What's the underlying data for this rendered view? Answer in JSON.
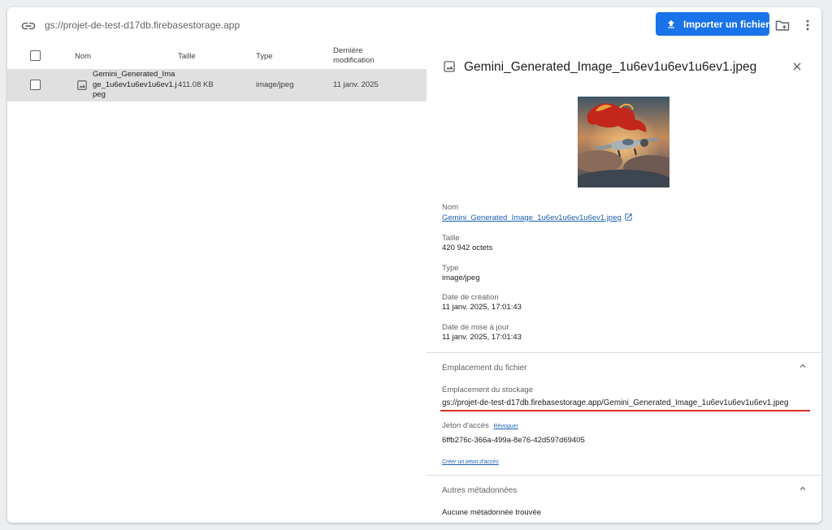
{
  "topbar": {
    "bucket_path": "gs://projet-de-test-d17db.firebasestorage.app",
    "upload_label": "Importer un fichier",
    "icons": [
      "link-icon",
      "upload-icon",
      "create-folder-icon",
      "more-vert-icon"
    ]
  },
  "table": {
    "columns": {
      "name": "Nom",
      "size": "Taille",
      "type": "Type",
      "modified": "Dernière modification"
    },
    "rows": [
      {
        "name": "Gemini_Generated_Image_1u6ev1u6ev1u6ev1.jpeg",
        "size": "411.08 KB",
        "type": "image/jpeg",
        "modified": "11 janv. 2025"
      }
    ]
  },
  "panel": {
    "title": "Gemini_Generated_Image_1u6ev1u6ev1u6ev1.jpeg",
    "fields": {
      "name_label": "Nom",
      "name_value": "Gemini_Generated_Image_1u6ev1u6ev1u6ev1.jpeg",
      "size_label": "Taille",
      "size_value": "420 942 octets",
      "type_label": "Type",
      "type_value": "image/jpeg",
      "created_label": "Date de création",
      "created_value": "11 janv. 2025, 17:01:43",
      "updated_label": "Date de mise à jour",
      "updated_value": "11 janv. 2025, 17:01:43"
    },
    "location_section": {
      "title": "Emplacement du fichier",
      "storage_label": "Emplacement du stockage",
      "storage_value": "gs://projet-de-test-d17db.firebasestorage.app/Gemini_Generated_Image_1u6ev1u6ev1u6ev1.jpeg",
      "token_label": "Jeton d'accès",
      "revoke_label": "Révoquer",
      "token_value": "6ffb276c-366a-499a-8e76-42d597d69405",
      "create_token_label": "Créer un jeton d'accès"
    },
    "metadata_section": {
      "title": "Autres métadonnées",
      "empty_text": "Aucune métadonnée trouvée"
    }
  },
  "colors": {
    "accent": "#1a73e8",
    "selected_row": "#e0e0e0",
    "highlight_underline": "#d93025"
  }
}
